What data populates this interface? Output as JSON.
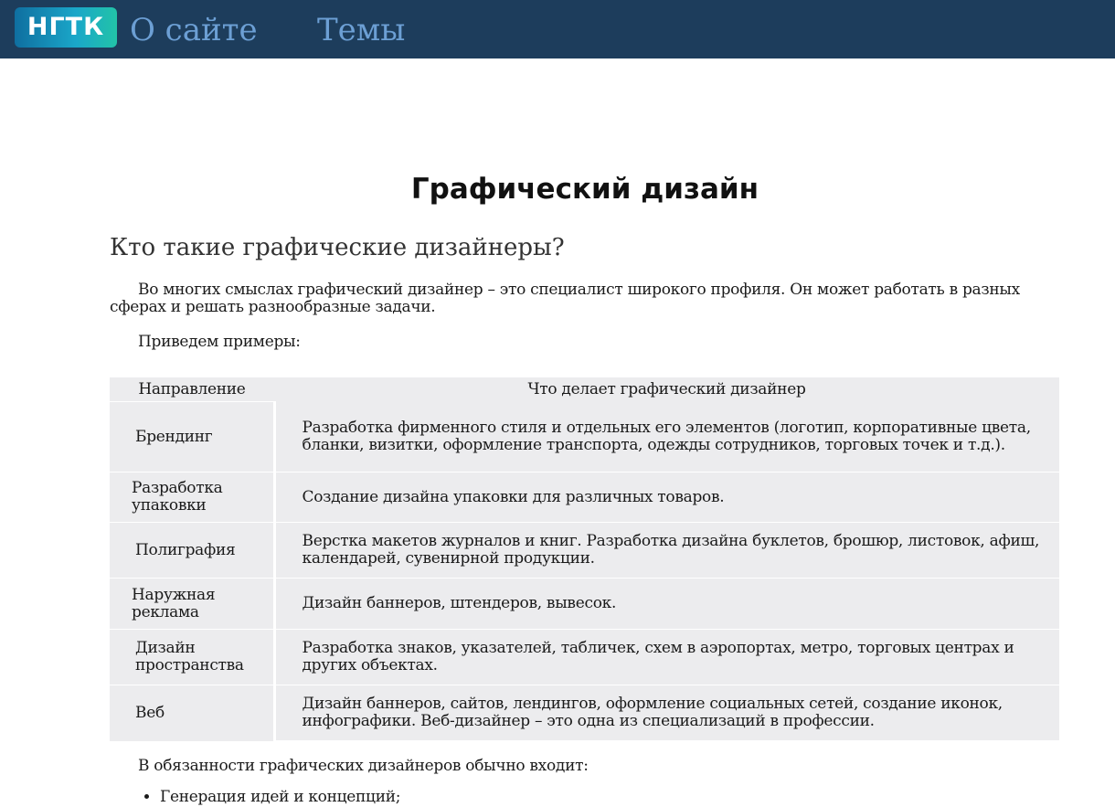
{
  "header": {
    "logo_text": "НГТК",
    "nav": [
      {
        "label": "О сайте"
      },
      {
        "label": "Темы"
      }
    ],
    "background_color": "#1d3d5c",
    "link_color": "#6c9fd4"
  },
  "main": {
    "page_title": "Графический дизайн",
    "section_title": "Кто такие графические дизайнеры?",
    "intro_paragraph": "Во многих смыслах графический дизайнер – это специалист широкого профиля. Он может работать в разных сферах и решать разнообразные задачи.",
    "examples_paragraph": "Приведем примеры:",
    "table": {
      "headers": [
        "Направление",
        "Что делает графический дизайнер"
      ],
      "rows": [
        {
          "direction": "Брендинг",
          "description": "Разработка фирменного стиля и отдельных его элементов (логотип, корпоративные цвета, бланки, визитки, оформление транспорта, одежды сотрудников, торговых точек и т.д.)."
        },
        {
          "direction": "Разработка упаковки",
          "description": "Создание дизайна упаковки для различных товаров."
        },
        {
          "direction": "Полиграфия",
          "description": "Верстка макетов журналов и книг. Разработка дизайна буклетов, брошюр, листовок, афиш, календарей, сувенирной продукции."
        },
        {
          "direction": "Наружная реклама",
          "description": "Дизайн баннеров, штендеров, вывесок."
        },
        {
          "direction": "Дизайн пространства",
          "description": "Разработка знаков, указателей, табличек, схем в аэропортах, метро, торговых центрах и других объектах."
        },
        {
          "direction": "Веб",
          "description": "Дизайн баннеров, сайтов, лендингов, оформление социальных сетей, создание иконок, инфографики. Веб-дизайнер – это одна из специализаций в профессии."
        }
      ]
    },
    "duties_paragraph": "В обязанности графических дизайнеров обычно входит:",
    "duties_list": [
      "Генерация идей и концепций;"
    ]
  }
}
